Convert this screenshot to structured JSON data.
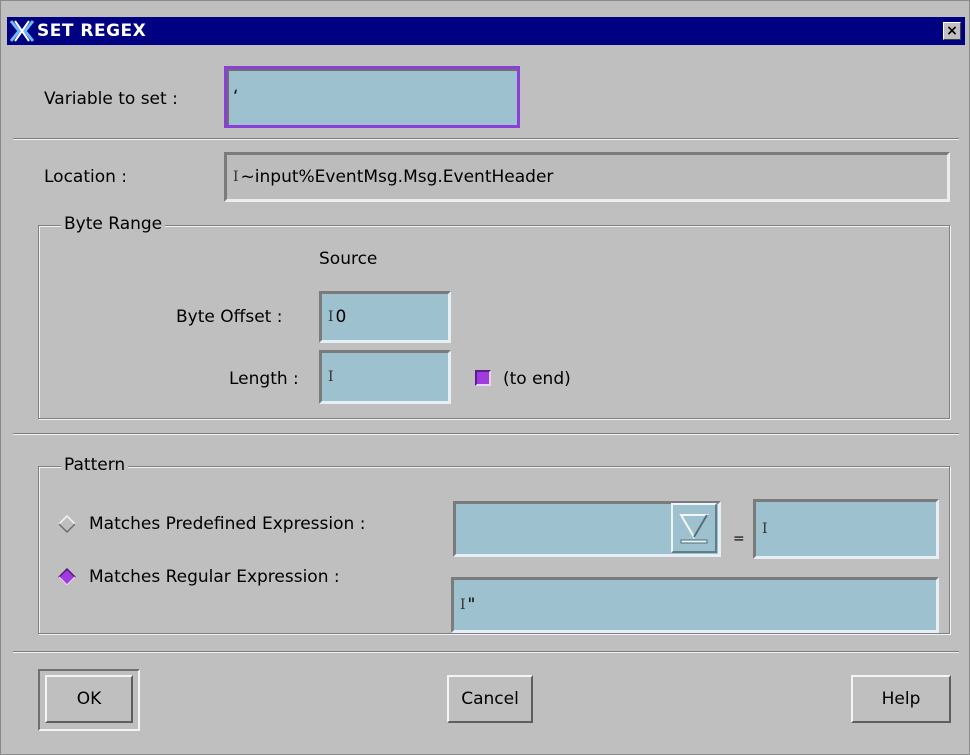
{
  "window": {
    "title": "SET REGEX",
    "close_glyph": "×"
  },
  "variable": {
    "label": "Variable to set :",
    "value": "‘"
  },
  "location": {
    "label": "Location :",
    "value": "~input%EventMsg.Msg.EventHeader"
  },
  "byte_range": {
    "legend": "Byte Range",
    "source_heading": "Source",
    "offset_label": "Byte Offset :",
    "offset_value": "0",
    "length_label": "Length :",
    "length_value": "",
    "to_end_label": "(to end)",
    "to_end_checked": true
  },
  "pattern": {
    "legend": "Pattern",
    "predefined_label": "Matches Predefined Expression :",
    "predefined_selected": false,
    "predefined_combo_value": "",
    "equals_label": "=",
    "predefined_value": "",
    "regex_label": "Matches Regular Expression :",
    "regex_selected": true,
    "regex_value": "\""
  },
  "buttons": {
    "ok": "OK",
    "cancel": "Cancel",
    "help": "Help"
  },
  "colors": {
    "title_bar": "#000082",
    "field_bg": "#9ec1cf",
    "focus_border": "#8b3fd9",
    "check_fill": "#a03be0",
    "dialog_bg": "#bfbfbf"
  },
  "icons": {
    "title_logo": "x-logo-icon",
    "close": "close-icon",
    "combo_arrow": "triangle-down-icon",
    "caret": "text-cursor-icon"
  }
}
